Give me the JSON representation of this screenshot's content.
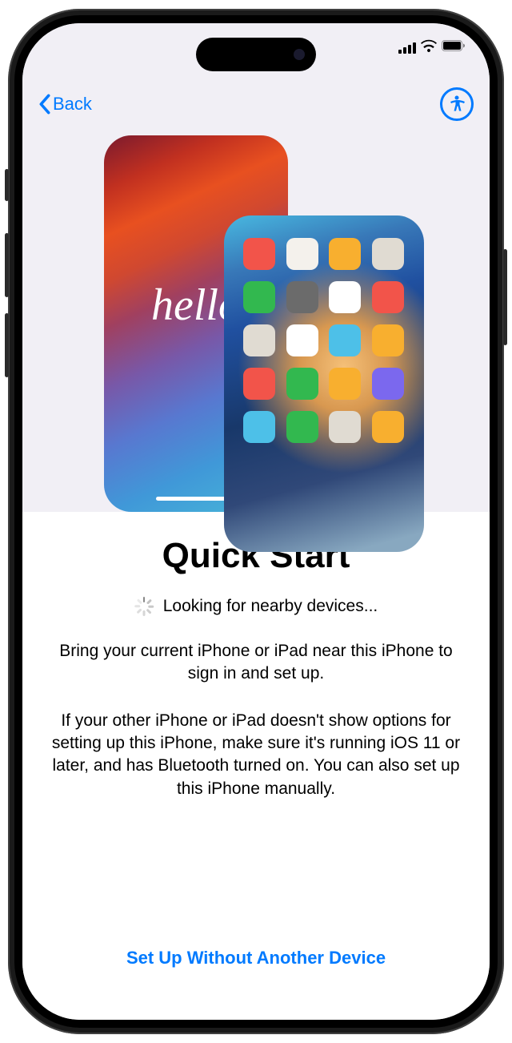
{
  "nav": {
    "back_label": "Back"
  },
  "illustration": {
    "hello_text": "hello",
    "app_colors": [
      "#f2544a",
      "#f4f1ec",
      "#f8af2f",
      "#e0dbd2",
      "#32b84f",
      "#6b6b6b",
      "#ffffff",
      "#f2544a",
      "#e0dbd2",
      "#ffffff",
      "#4dc0e8",
      "#f8af2f",
      "#f2544a",
      "#32b84f",
      "#f8af2f",
      "#7b68ee",
      "#4dc0e8",
      "#32b84f",
      "#e0dbd2",
      "#f8af2f"
    ]
  },
  "content": {
    "title": "Quick Start",
    "status_text": "Looking for nearby devices...",
    "body_1": "Bring your current iPhone or iPad near this iPhone to sign in and set up.",
    "body_2": "If your other iPhone or iPad doesn't show options for setting up this iPhone, make sure it's running iOS 11 or later, and has Bluetooth turned on. You can also set up this iPhone manually."
  },
  "footer": {
    "setup_manually_label": "Set Up Without Another Device"
  }
}
